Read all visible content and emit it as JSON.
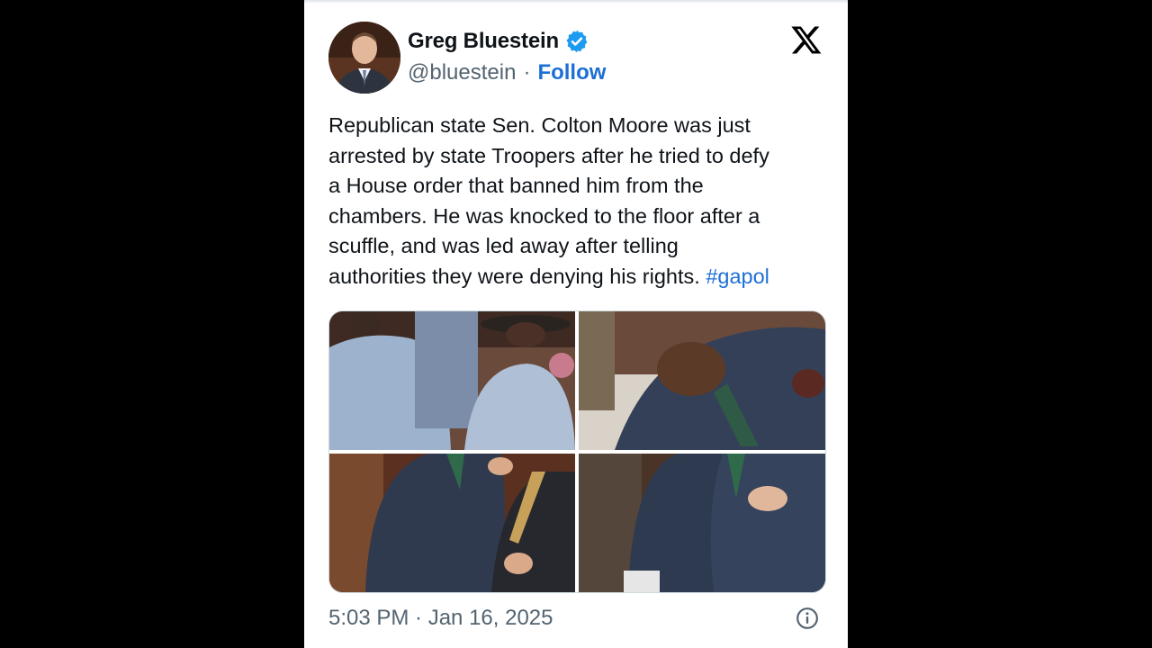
{
  "author": {
    "display_name": "Greg Bluestein",
    "handle": "@bluestein",
    "separator": "·",
    "follow_label": "Follow",
    "avatar_icon": "profile-photo",
    "verified_icon": "verified-badge-icon",
    "verified_color": "#1d9bf0"
  },
  "platform": {
    "logo_icon": "x-logo-icon"
  },
  "tweet": {
    "text": "Republican state Sen. Colton Moore was just\narrested by state Troopers after he tried to defy\na House order that banned him from the\nchambers. He was knocked to the floor after a\nscuffle, and was led away after telling\nauthorities they were denying his rights. ",
    "hashtag": "#gapol",
    "link_color": "#1d6fd6",
    "text_color": "#0f1419"
  },
  "media": {
    "photos": [
      {
        "name": "photo-troopers"
      },
      {
        "name": "photo-knocked-down"
      },
      {
        "name": "photo-led-away"
      },
      {
        "name": "photo-scuffle"
      }
    ]
  },
  "meta": {
    "timestamp": "5:03 PM · Jan 16, 2025",
    "info_icon": "info-icon",
    "muted_color": "#536471"
  }
}
